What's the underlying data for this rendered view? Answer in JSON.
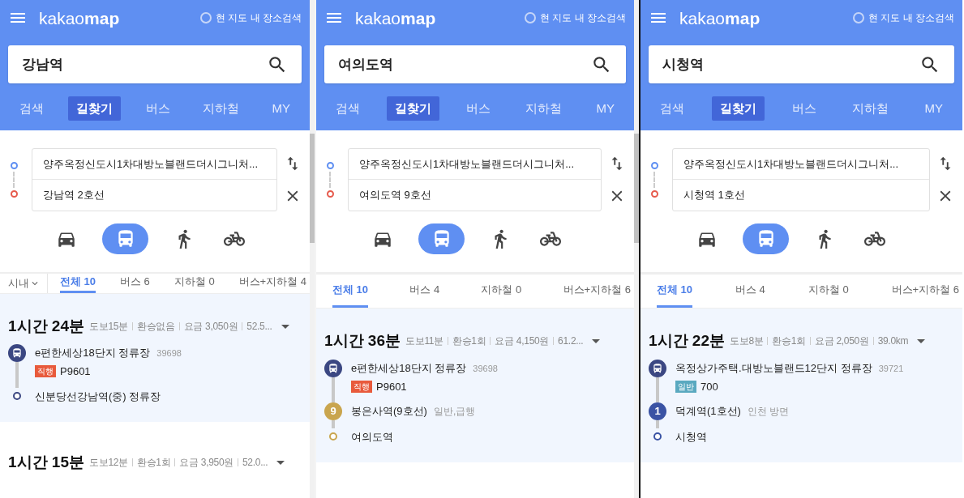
{
  "panels": [
    {
      "logo": {
        "light": "kakao",
        "bold": "map"
      },
      "map_search_toggle": {
        "label": "현 지도 내 장소검색",
        "checked": false
      },
      "search": {
        "value": "강남역"
      },
      "scrollbar": true,
      "nav_tabs": [
        {
          "label": "검색",
          "selected": false
        },
        {
          "label": "길찾기",
          "selected": true
        },
        {
          "label": "버스",
          "selected": false
        },
        {
          "label": "지하철",
          "selected": false
        },
        {
          "label": "MY",
          "selected": false
        }
      ],
      "origin": "양주옥정신도시1차대방노블랜드더시그니처...",
      "destination": "강남역 2호선",
      "modes": [
        {
          "kind": "car",
          "selected": false
        },
        {
          "kind": "bus",
          "selected": true
        },
        {
          "kind": "walk",
          "selected": false
        },
        {
          "kind": "bike",
          "selected": false
        }
      ],
      "region_filter": "시내",
      "result_tabs": [
        {
          "label": "전체 10",
          "selected": true
        },
        {
          "label": "버스 6",
          "selected": false
        },
        {
          "label": "지하철 0",
          "selected": false
        },
        {
          "label": "버스+지하철 4",
          "selected": false
        }
      ],
      "routes": [
        {
          "time": "1시간 24분",
          "meta": [
            "도보15분",
            "환승없음",
            "요금 3,050원",
            "52.5..."
          ],
          "highlighted": true,
          "steps": [
            {
              "kind": "bus",
              "color": "#3b4782",
              "name": "e편한세상18단지 정류장",
              "code": "39698",
              "badge": {
                "text": "직행",
                "color": "#e85a3c"
              },
              "route": "P9601"
            },
            {
              "kind": "end",
              "color": "#3b4782",
              "name": "신분당선강남역(중) 정류장"
            }
          ]
        },
        {
          "time": "1시간 15분",
          "meta": [
            "도보12분",
            "환승1회",
            "요금 3,950원",
            "52.0..."
          ],
          "highlighted": false
        }
      ]
    },
    {
      "logo": {
        "light": "kakao",
        "bold": "map"
      },
      "map_search_toggle": {
        "label": "현 지도 내 장소검색",
        "checked": false
      },
      "search": {
        "value": "여의도역"
      },
      "scrollbar": true,
      "nav_tabs": [
        {
          "label": "검색",
          "selected": false
        },
        {
          "label": "길찾기",
          "selected": true
        },
        {
          "label": "버스",
          "selected": false
        },
        {
          "label": "지하철",
          "selected": false
        },
        {
          "label": "MY",
          "selected": false
        }
      ],
      "origin": "양주옥정신도시1차대방노블랜드더시그니처...",
      "destination": "여의도역 9호선",
      "modes": [
        {
          "kind": "car",
          "selected": false
        },
        {
          "kind": "bus",
          "selected": true
        },
        {
          "kind": "walk",
          "selected": false
        },
        {
          "kind": "bike",
          "selected": false
        }
      ],
      "result_tabs": [
        {
          "label": "전체 10",
          "selected": true
        },
        {
          "label": "버스 4",
          "selected": false
        },
        {
          "label": "지하철 0",
          "selected": false
        },
        {
          "label": "버스+지하철 6",
          "selected": false
        }
      ],
      "routes": [
        {
          "time": "1시간 36분",
          "meta": [
            "도보11분",
            "환승1회",
            "요금 4,150원",
            "61.2..."
          ],
          "highlighted": true,
          "steps": [
            {
              "kind": "bus",
              "color": "#3b4782",
              "name": "e편한세상18단지 정류장",
              "code": "39698",
              "badge": {
                "text": "직행",
                "color": "#e85a3c"
              },
              "route": "P9601"
            },
            {
              "kind": "subway",
              "color": "#c9a54e",
              "marker": "9",
              "name": "봉은사역(9호선)",
              "note": "일반,급행"
            },
            {
              "kind": "end",
              "color": "#c9a54e",
              "name": "여의도역"
            }
          ]
        }
      ]
    },
    {
      "logo": {
        "light": "kakao",
        "bold": "map"
      },
      "map_search_toggle": {
        "label": "현 지도 내 장소검색",
        "checked": false
      },
      "search": {
        "value": "시청역"
      },
      "nav_tabs": [
        {
          "label": "검색",
          "selected": false
        },
        {
          "label": "길찾기",
          "selected": true
        },
        {
          "label": "버스",
          "selected": false
        },
        {
          "label": "지하철",
          "selected": false
        },
        {
          "label": "MY",
          "selected": false
        }
      ],
      "origin": "양주옥정신도시1차대방노블랜드더시그니처...",
      "destination": "시청역 1호선",
      "modes": [
        {
          "kind": "car",
          "selected": false
        },
        {
          "kind": "bus",
          "selected": true
        },
        {
          "kind": "walk",
          "selected": false
        },
        {
          "kind": "bike",
          "selected": false
        }
      ],
      "result_tabs": [
        {
          "label": "전체 10",
          "selected": true
        },
        {
          "label": "버스 4",
          "selected": false
        },
        {
          "label": "지하철 0",
          "selected": false
        },
        {
          "label": "버스+지하철 6",
          "selected": false
        }
      ],
      "routes": [
        {
          "time": "1시간 22분",
          "meta": [
            "도보8분",
            "환승1회",
            "요금 2,050원",
            "39.0km"
          ],
          "highlighted": true,
          "steps": [
            {
              "kind": "bus",
              "color": "#3b4782",
              "name": "옥정상가주택.대방노블랜드12단지 정류장",
              "code": "39721",
              "badge": {
                "text": "일반",
                "color": "#5aa9c0"
              },
              "route": "700"
            },
            {
              "kind": "subway",
              "color": "#3a53a4",
              "marker": "1",
              "name": "덕계역(1호선)",
              "note": "인천 방면"
            },
            {
              "kind": "end",
              "color": "#3a53a4",
              "name": "시청역"
            }
          ]
        }
      ]
    }
  ]
}
